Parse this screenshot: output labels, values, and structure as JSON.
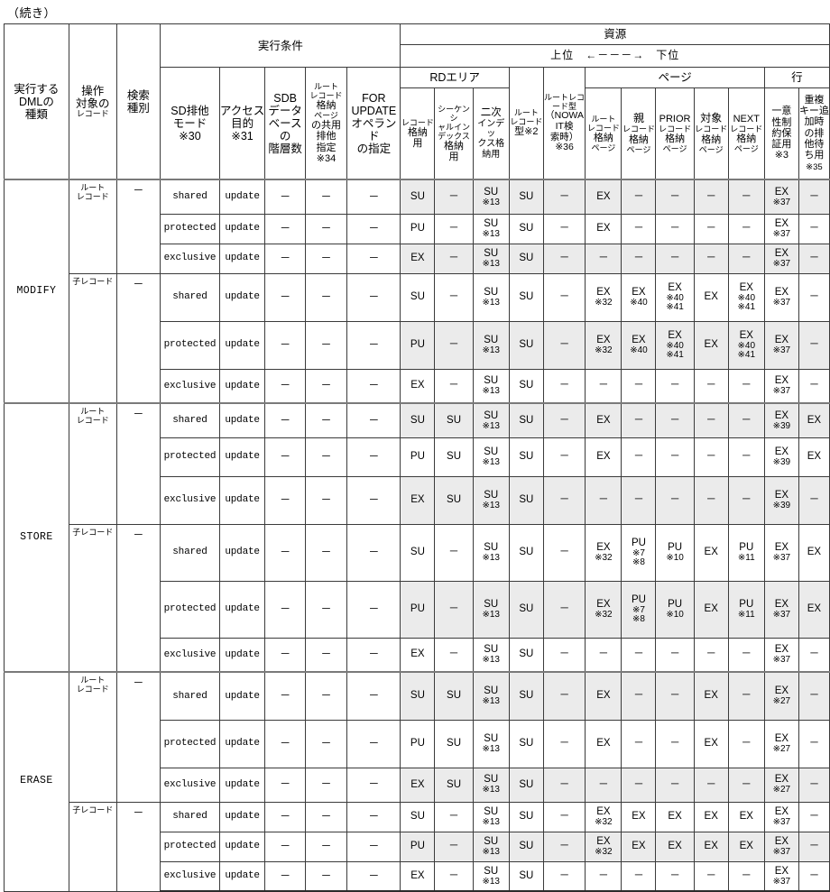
{
  "page": {
    "continued_label": "（続き）"
  },
  "colors": {
    "shade": "#ebebeb",
    "rule": "#3b3b3b",
    "heavy_rule": "#2b2b2b"
  },
  "header": {
    "group_exec_cond": "実行条件",
    "group_resource": "資源",
    "order_note": {
      "high": "上位",
      "arrow": "←－－－→",
      "low": "下位"
    },
    "col_dml": "実行する\nDMLの\n種類",
    "col_dml_l1": "実行する",
    "col_dml_l2": "DMLの",
    "col_dml_l3": "種類",
    "col_target_l1": "操作",
    "col_target_l2": "対象の",
    "col_target_l3": "レコード",
    "col_search_l1": "検索",
    "col_search_l2": "種別",
    "col_sdmode_l1": "SD排他",
    "col_sdmode_l2": "モード",
    "col_sdmode_l3": "※30",
    "col_access_l1": "アクセス",
    "col_access_l2": "目的",
    "col_access_l3": "※31",
    "col_sdb_l1": "SDB",
    "col_sdb_l2": "データ",
    "col_sdb_l3": "ベースの",
    "col_sdb_l4": "階層数",
    "col_rootpage_l1": "ルート",
    "col_rootpage_l2": "レコード",
    "col_rootpage_l3": "格納",
    "col_rootpage_l4": "ページ",
    "col_rootpage_l5": "の共用",
    "col_rootpage_l6": "排他",
    "col_rootpage_l7": "指定",
    "col_rootpage_l8": "※34",
    "col_forupd_l1": "FOR",
    "col_forupd_l2": "UPDATE",
    "col_forupd_l3": "オペランド",
    "col_forupd_l4": "の指定",
    "grp_rdarea": "RDエリア",
    "grp_page": "ページ",
    "grp_row": "行",
    "col_rec_l1": "レコード",
    "col_rec_l2": "格納",
    "col_rec_l3": "用",
    "col_seq_l1": "シーケンシ",
    "col_seq_l2": "ャルイン",
    "col_seq_l3": "デックス",
    "col_seq_l4": "格納",
    "col_seq_l5": "用",
    "col_2nd_l1": "二次",
    "col_2nd_l2": "インデッ",
    "col_2nd_l3": "クス格",
    "col_2nd_l4": "納用",
    "col_roottype_l1": "ルート",
    "col_roottype_l2": "レコード",
    "col_roottype_l3": "型※2",
    "col_rootrec_l1": "ルートレコ",
    "col_rootrec_l2": "ード型",
    "col_rootrec_l3": "（NOWA",
    "col_rootrec_l4": "IT検",
    "col_rootrec_l5": "索時）",
    "col_rootrec_l6": "※36",
    "col_pg_root_l1": "ルート",
    "col_pg_root_l2": "レコード",
    "col_pg_root_l3": "格納",
    "col_pg_root_l4": "ページ",
    "col_pg_parent_l1": "親",
    "col_pg_parent_l2": "レコード",
    "col_pg_parent_l3": "格納",
    "col_pg_parent_l4": "ページ",
    "col_pg_prior_l1": "PRIOR",
    "col_pg_prior_l2": "レコード",
    "col_pg_prior_l3": "格納",
    "col_pg_prior_l4": "ページ",
    "col_pg_target_l1": "対象",
    "col_pg_target_l2": "レコード",
    "col_pg_target_l3": "格納",
    "col_pg_target_l4": "ページ",
    "col_pg_next_l1": "NEXT",
    "col_pg_next_l2": "レコード",
    "col_pg_next_l3": "格納",
    "col_pg_next_l4": "ページ",
    "col_uniq_l1": "一意",
    "col_uniq_l2": "性制",
    "col_uniq_l3": "約保",
    "col_uniq_l4": "証用",
    "col_uniq_l5": "※3",
    "col_dup_l1": "重複",
    "col_dup_l2": "キー追",
    "col_dup_l3": "加時",
    "col_dup_l4": "の排",
    "col_dup_l5": "他待",
    "col_dup_l6": "ち用",
    "col_dup_l7": "※35"
  },
  "labels": {
    "dash": "－",
    "root_record_l1": "ルート",
    "root_record_l2": "レコード",
    "child_record": "子レコード",
    "shared": "shared",
    "protected": "protected",
    "exclusive": "exclusive",
    "update": "update"
  },
  "rows": [
    {
      "dml": "MODIFY",
      "target": "root",
      "search": "－",
      "mode": "shared",
      "access": "update",
      "sdb": "－",
      "rootpage": "－",
      "forupd": "－",
      "cells": [
        "SU",
        "－",
        {
          "v": "SU",
          "n": "※13"
        },
        "SU",
        "－",
        "EX",
        "－",
        "－",
        "－",
        "－",
        {
          "v": "EX",
          "n": "※37"
        },
        "－"
      ]
    },
    {
      "dml": "",
      "target": "",
      "search": "",
      "mode": "protected",
      "access": "update",
      "sdb": "－",
      "rootpage": "－",
      "forupd": "－",
      "cells": [
        "PU",
        "－",
        {
          "v": "SU",
          "n": "※13"
        },
        "SU",
        "－",
        "EX",
        "－",
        "－",
        "－",
        "－",
        {
          "v": "EX",
          "n": "※37"
        },
        "－"
      ]
    },
    {
      "dml": "",
      "target": "",
      "search": "",
      "mode": "exclusive",
      "access": "update",
      "sdb": "－",
      "rootpage": "－",
      "forupd": "－",
      "cells": [
        "EX",
        "－",
        {
          "v": "SU",
          "n": "※13"
        },
        "SU",
        "－",
        "－",
        "－",
        "－",
        "－",
        "－",
        {
          "v": "EX",
          "n": "※37"
        },
        "－"
      ]
    },
    {
      "dml": "",
      "target": "child",
      "search": "－",
      "mode": "shared",
      "access": "update",
      "sdb": "－",
      "rootpage": "－",
      "forupd": "－",
      "cells": [
        "SU",
        "－",
        {
          "v": "SU",
          "n": "※13"
        },
        "SU",
        "－",
        {
          "v": "EX",
          "n": "※32"
        },
        {
          "v": "EX",
          "n": "※40"
        },
        {
          "v": "EX",
          "n": "※40",
          "n2": "※41"
        },
        "EX",
        {
          "v": "EX",
          "n": "※40",
          "n2": "※41"
        },
        {
          "v": "EX",
          "n": "※37"
        },
        "－"
      ]
    },
    {
      "dml": "",
      "target": "",
      "search": "",
      "mode": "protected",
      "access": "update",
      "sdb": "－",
      "rootpage": "－",
      "forupd": "－",
      "cells": [
        "PU",
        "－",
        {
          "v": "SU",
          "n": "※13"
        },
        "SU",
        "－",
        {
          "v": "EX",
          "n": "※32"
        },
        {
          "v": "EX",
          "n": "※40"
        },
        {
          "v": "EX",
          "n": "※40",
          "n2": "※41"
        },
        "EX",
        {
          "v": "EX",
          "n": "※40",
          "n2": "※41"
        },
        {
          "v": "EX",
          "n": "※37"
        },
        "－"
      ]
    },
    {
      "dml": "",
      "target": "",
      "search": "",
      "mode": "exclusive",
      "access": "update",
      "sdb": "－",
      "rootpage": "－",
      "forupd": "－",
      "cells": [
        "EX",
        "－",
        {
          "v": "SU",
          "n": "※13"
        },
        "SU",
        "－",
        "－",
        "－",
        "－",
        "－",
        "－",
        {
          "v": "EX",
          "n": "※37"
        },
        "－"
      ]
    },
    {
      "dml": "STORE",
      "target": "root",
      "search": "－",
      "mode": "shared",
      "access": "update",
      "sdb": "－",
      "rootpage": "－",
      "forupd": "－",
      "cells": [
        "SU",
        "SU",
        {
          "v": "SU",
          "n": "※13"
        },
        "SU",
        "－",
        "EX",
        "－",
        "－",
        "－",
        "－",
        {
          "v": "EX",
          "n": "※39"
        },
        "EX"
      ]
    },
    {
      "dml": "",
      "target": "",
      "search": "",
      "mode": "protected",
      "access": "update",
      "sdb": "－",
      "rootpage": "－",
      "forupd": "－",
      "cells": [
        "PU",
        "SU",
        {
          "v": "SU",
          "n": "※13"
        },
        "SU",
        "－",
        "EX",
        "－",
        "－",
        "－",
        "－",
        {
          "v": "EX",
          "n": "※39"
        },
        "EX"
      ]
    },
    {
      "dml": "",
      "target": "",
      "search": "",
      "mode": "exclusive",
      "access": "update",
      "sdb": "－",
      "rootpage": "－",
      "forupd": "－",
      "cells": [
        "EX",
        "SU",
        {
          "v": "SU",
          "n": "※13"
        },
        "SU",
        "－",
        "－",
        "－",
        "－",
        "－",
        "－",
        {
          "v": "EX",
          "n": "※39"
        },
        "－"
      ]
    },
    {
      "dml": "",
      "target": "child",
      "search": "－",
      "mode": "shared",
      "access": "update",
      "sdb": "－",
      "rootpage": "－",
      "forupd": "－",
      "cells": [
        "SU",
        "－",
        {
          "v": "SU",
          "n": "※13"
        },
        "SU",
        "－",
        {
          "v": "EX",
          "n": "※32"
        },
        {
          "v": "PU",
          "n": "※7",
          "n2": "※8"
        },
        {
          "v": "PU",
          "n": "※10"
        },
        "EX",
        {
          "v": "PU",
          "n": "※11"
        },
        {
          "v": "EX",
          "n": "※37"
        },
        "EX"
      ]
    },
    {
      "dml": "",
      "target": "",
      "search": "",
      "mode": "protected",
      "access": "update",
      "sdb": "－",
      "rootpage": "－",
      "forupd": "－",
      "cells": [
        "PU",
        "－",
        {
          "v": "SU",
          "n": "※13"
        },
        "SU",
        "－",
        {
          "v": "EX",
          "n": "※32"
        },
        {
          "v": "PU",
          "n": "※7",
          "n2": "※8"
        },
        {
          "v": "PU",
          "n": "※10"
        },
        "EX",
        {
          "v": "PU",
          "n": "※11"
        },
        {
          "v": "EX",
          "n": "※37"
        },
        "EX"
      ]
    },
    {
      "dml": "",
      "target": "",
      "search": "",
      "mode": "exclusive",
      "access": "update",
      "sdb": "－",
      "rootpage": "－",
      "forupd": "－",
      "cells": [
        "EX",
        "－",
        {
          "v": "SU",
          "n": "※13"
        },
        "SU",
        "－",
        "－",
        "－",
        "－",
        "－",
        "－",
        {
          "v": "EX",
          "n": "※37"
        },
        "－"
      ]
    },
    {
      "dml": "ERASE",
      "target": "root",
      "search": "－",
      "mode": "shared",
      "access": "update",
      "sdb": "－",
      "rootpage": "－",
      "forupd": "－",
      "cells": [
        "SU",
        "SU",
        {
          "v": "SU",
          "n": "※13"
        },
        "SU",
        "－",
        "EX",
        "－",
        "－",
        "EX",
        "－",
        {
          "v": "EX",
          "n": "※27"
        },
        "－"
      ]
    },
    {
      "dml": "",
      "target": "",
      "search": "",
      "mode": "protected",
      "access": "update",
      "sdb": "－",
      "rootpage": "－",
      "forupd": "－",
      "cells": [
        "PU",
        "SU",
        {
          "v": "SU",
          "n": "※13"
        },
        "SU",
        "－",
        "EX",
        "－",
        "－",
        "EX",
        "－",
        {
          "v": "EX",
          "n": "※27"
        },
        "－"
      ]
    },
    {
      "dml": "",
      "target": "",
      "search": "",
      "mode": "exclusive",
      "access": "update",
      "sdb": "－",
      "rootpage": "－",
      "forupd": "－",
      "cells": [
        "EX",
        "SU",
        {
          "v": "SU",
          "n": "※13"
        },
        "SU",
        "－",
        "－",
        "－",
        "－",
        "－",
        "－",
        {
          "v": "EX",
          "n": "※27"
        },
        "－"
      ]
    },
    {
      "dml": "",
      "target": "child",
      "search": "－",
      "mode": "shared",
      "access": "update",
      "sdb": "－",
      "rootpage": "－",
      "forupd": "－",
      "cells": [
        "SU",
        "－",
        {
          "v": "SU",
          "n": "※13"
        },
        "SU",
        "－",
        {
          "v": "EX",
          "n": "※32"
        },
        "EX",
        "EX",
        "EX",
        "EX",
        {
          "v": "EX",
          "n": "※37"
        },
        "－"
      ]
    },
    {
      "dml": "",
      "target": "",
      "search": "",
      "mode": "protected",
      "access": "update",
      "sdb": "－",
      "rootpage": "－",
      "forupd": "－",
      "cells": [
        "PU",
        "－",
        {
          "v": "SU",
          "n": "※13"
        },
        "SU",
        "－",
        {
          "v": "EX",
          "n": "※32"
        },
        "EX",
        "EX",
        "EX",
        "EX",
        {
          "v": "EX",
          "n": "※37"
        },
        "－"
      ]
    },
    {
      "dml": "",
      "target": "",
      "search": "",
      "mode": "exclusive",
      "access": "update",
      "sdb": "－",
      "rootpage": "－",
      "forupd": "－",
      "cells": [
        "EX",
        "－",
        {
          "v": "SU",
          "n": "※13"
        },
        "SU",
        "－",
        "－",
        "－",
        "－",
        "－",
        "－",
        {
          "v": "EX",
          "n": "※37"
        },
        "－"
      ]
    }
  ],
  "row_layout": {
    "heights": [
      38,
      33,
      33,
      53,
      53,
      38,
      38,
      43,
      53,
      63,
      63,
      38,
      53,
      53,
      38,
      33,
      33,
      33
    ],
    "group_starts": [
      0,
      6,
      12
    ],
    "target_spans": [
      3,
      3,
      3,
      3,
      3,
      3
    ]
  }
}
